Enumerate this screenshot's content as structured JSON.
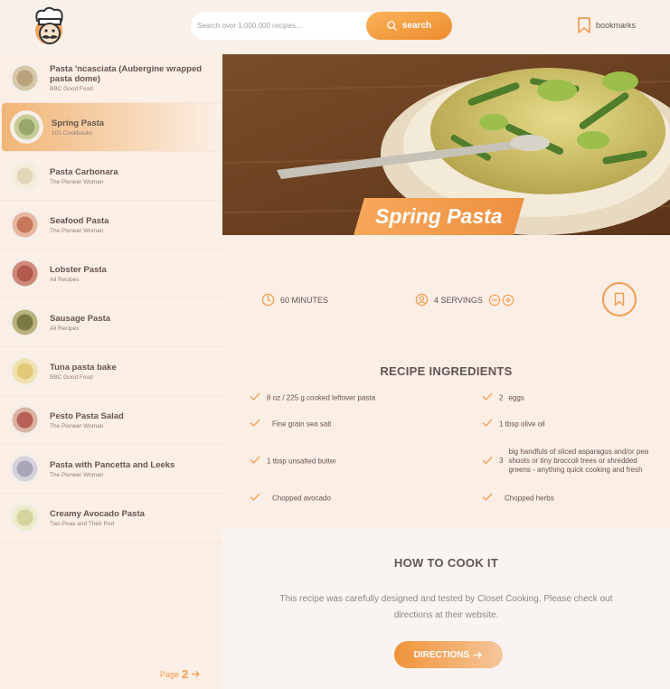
{
  "colors": {
    "accent": "#f19d4f",
    "accent_dark": "#ed8b2d",
    "text": "#615551"
  },
  "search": {
    "placeholder": "Search over 1,000,000 recipes...",
    "button_label": "search"
  },
  "header": {
    "bookmarks_label": "bookmarks",
    "logo_icon": "chef-logo-icon"
  },
  "results": [
    {
      "title": "Pasta 'ncasciata (Aubergine wrapped pasta dome)",
      "source": "BBC Good Food"
    },
    {
      "title": "Spring Pasta",
      "source": "101 Cookbooks",
      "active": true
    },
    {
      "title": "Pasta Carbonara",
      "source": "The Pioneer Woman"
    },
    {
      "title": "Seafood Pasta",
      "source": "The Pioneer Woman"
    },
    {
      "title": "Lobster Pasta",
      "source": "All Recipes"
    },
    {
      "title": "Sausage Pasta",
      "source": "All Recipes"
    },
    {
      "title": "Tuna pasta bake",
      "source": "BBC Good Food"
    },
    {
      "title": "Pesto Pasta Salad",
      "source": "The Pioneer Woman"
    },
    {
      "title": "Pasta with Pancetta and Leeks",
      "source": "The Pioneer Woman"
    },
    {
      "title": "Creamy Avocado Pasta",
      "source": "Two Peas and Their Pod"
    }
  ],
  "pagination": {
    "label": "Page",
    "number": "2"
  },
  "recipe": {
    "title": "Spring Pasta",
    "minutes": "60",
    "minutes_label": "MINUTES",
    "servings": "4",
    "servings_label": "SERVINGS"
  },
  "ingredients": {
    "heading": "RECIPE INGREDIENTS",
    "left": [
      {
        "qty": "",
        "text": "8 oz / 225 g cooked leftover pasta"
      },
      {
        "qty": "",
        "text": "Fine grain sea salt"
      },
      {
        "qty": "",
        "text": "1 tbsp unsalted butter"
      },
      {
        "qty": "",
        "text": "Chopped avocado"
      }
    ],
    "right": [
      {
        "qty": "2",
        "text": "eggs"
      },
      {
        "qty": "",
        "text": "1 tbsp olive oil"
      },
      {
        "qty": "3",
        "text": "big handfuls of sliced asparagus and/or pea shoots or tiny broccoli trees or shredded greens - anything quick cooking and fresh"
      },
      {
        "qty": "",
        "text": "Chopped herbs"
      }
    ]
  },
  "cook": {
    "heading": "HOW TO COOK IT",
    "description": "This recipe was carefully designed and tested by Closet Cooking. Please check out directions at their website.",
    "button_label": "DIRECTIONS"
  }
}
